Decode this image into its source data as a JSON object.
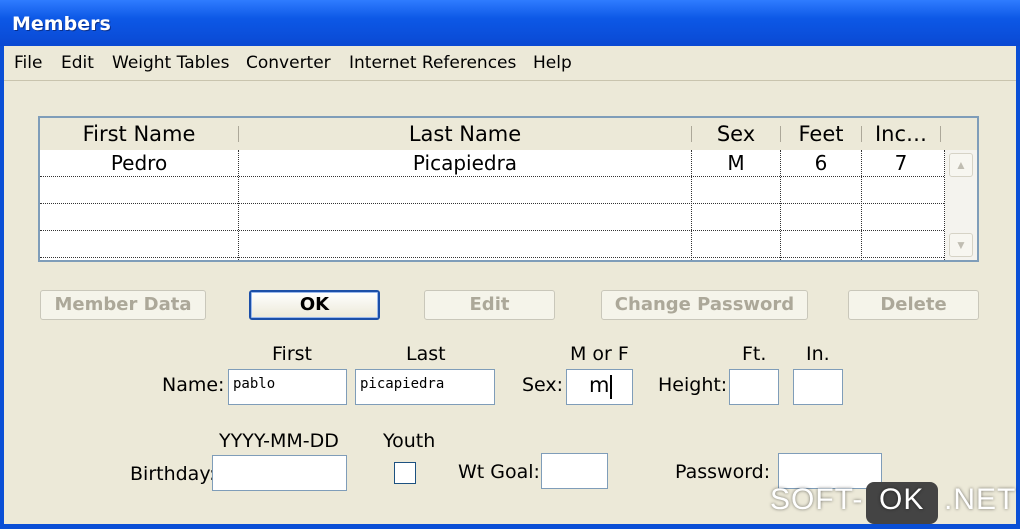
{
  "window": {
    "title": "Members"
  },
  "menu": [
    "File",
    "Edit",
    "Weight Tables",
    "Converter",
    "Internet References",
    "Help"
  ],
  "table": {
    "columns": [
      "First Name",
      "Last Name",
      "Sex",
      "Feet",
      "Inc…"
    ],
    "rows": [
      [
        "Pedro",
        "Picapiedra",
        "M",
        "6",
        "7"
      ]
    ]
  },
  "buttons": {
    "member_data": "Member Data",
    "ok": "OK",
    "edit": "Edit",
    "change_password": "Change Password",
    "delete": "Delete"
  },
  "form": {
    "first_header": "First",
    "last_header": "Last",
    "sex_header": "M or F",
    "ft_header": "Ft.",
    "in_header": "In.",
    "name_label": "Name:",
    "first_value": "pablo",
    "last_value": "picapiedra",
    "sex_label": "Sex:",
    "sex_value": "m",
    "height_label": "Height:",
    "feet_value": "",
    "inches_value": "",
    "date_hint": "YYYY-MM-DD",
    "birthday_label": "Birthday:",
    "birthday_value": "",
    "youth_label": "Youth",
    "youth_checked": false,
    "wtgoal_label": "Wt Goal:",
    "wtgoal_value": "",
    "password_label": "Password:",
    "password_value": ""
  },
  "watermark": {
    "left": "SOFT-",
    "box": "OK",
    "right": ".NET"
  },
  "colors": {
    "titlebar": "#0a4fd6",
    "face": "#ece9d8",
    "field_border": "#7f9db9",
    "disabled_text": "#aca899"
  }
}
